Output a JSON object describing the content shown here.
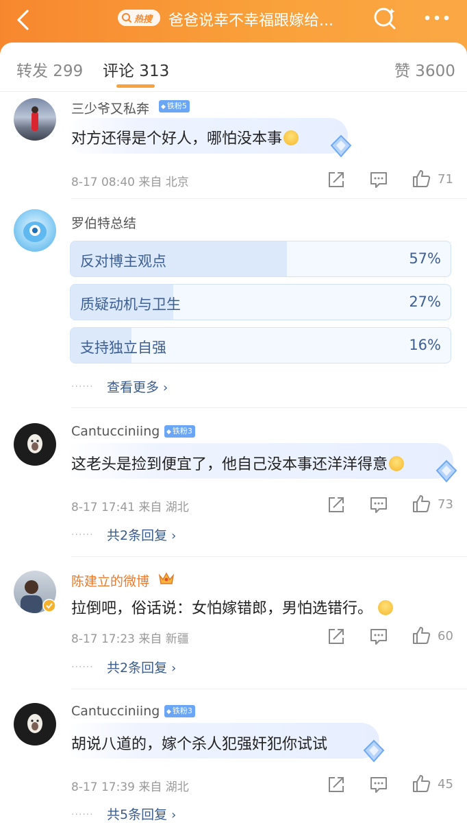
{
  "header": {
    "hot_label": "热搜",
    "title": "爸爸说幸不幸福跟嫁给..."
  },
  "tabs": {
    "repost": "转发 299",
    "comment": "评论 313",
    "like": "赞 3600"
  },
  "comments": [
    {
      "user": "三少爷又私奔",
      "badge": "铁粉5",
      "text": "对方还得是个好人，哪怕没本事",
      "meta": "8-17 08:40  来自 北京",
      "likes": "71"
    },
    {
      "user": "罗伯特总结",
      "poll": [
        {
          "label": "反对博主观点",
          "pct_text": "57%",
          "pct": 57
        },
        {
          "label": "质疑动机与卫生",
          "pct_text": "27%",
          "pct": 27
        },
        {
          "label": "支持独立自强",
          "pct_text": "16%",
          "pct": 16
        }
      ],
      "more": "查看更多"
    },
    {
      "user": "Cantucciniing",
      "badge": "铁粉3",
      "text": "这老头是捡到便宜了，他自己没本事还洋洋得意",
      "meta": "8-17 17:41  来自 湖北",
      "likes": "73",
      "replies": "共2条回复"
    },
    {
      "user": "陈建立的微博",
      "text": "拉倒吧，俗话说：女怕嫁错郎，男怕选错行。",
      "meta": "8-17 17:23  来自 新疆",
      "likes": "60",
      "replies": "共2条回复"
    },
    {
      "user": "Cantucciniing",
      "badge": "铁粉3",
      "text": "胡说八道的，嫁个杀人犯强奸犯你试试",
      "meta": "8-17 17:39  来自 湖北",
      "likes": "45",
      "replies": "共5条回复"
    }
  ],
  "colors": {
    "header_orange": "#f7872e",
    "accent_tab": "#f7a23c",
    "link_blue": "#3a5b8c",
    "fan_badge": "#6aa6f5",
    "vip_name": "#ea7a2c"
  },
  "icons": [
    "back-icon",
    "search-icon",
    "more-icon",
    "share-icon",
    "comment-icon",
    "like-icon",
    "diamond-icon",
    "crown-icon",
    "verified-icon"
  ]
}
